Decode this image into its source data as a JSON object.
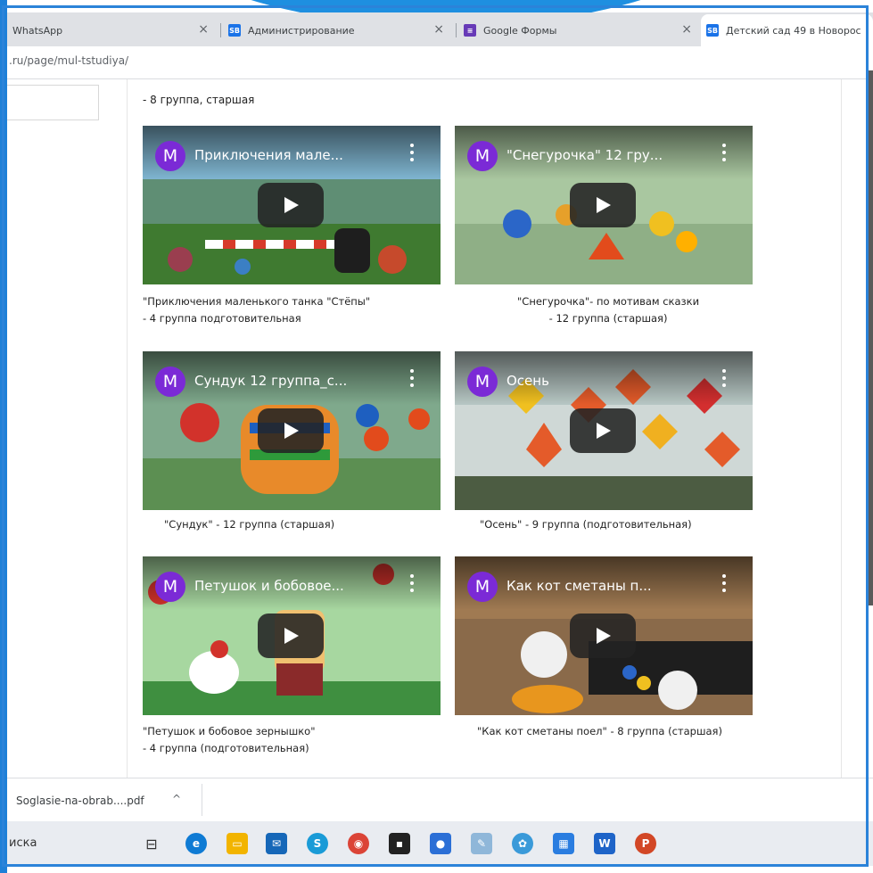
{
  "tabs": [
    {
      "title": "WhatsApp"
    },
    {
      "title": "Администрирование",
      "icon": "sites-icon"
    },
    {
      "title": "Google Формы",
      "icon": "forms-icon"
    },
    {
      "title": "Детский сад 49 в Новорос",
      "icon": "sites-icon"
    }
  ],
  "address": {
    "url": ".ru/page/mul-tstudiya/"
  },
  "top_label": "- 8 группа, старшая",
  "videos": [
    {
      "title": "Приключения мале...",
      "avatar": "М",
      "caption_line1": "\"Приключения маленького танка \"Стёпы\"",
      "caption_line2": "- 4 группа подготовительная"
    },
    {
      "title": "\"Снегурочка\" 12 гру...",
      "avatar": "М",
      "caption_line1": "\"Снегурочка\"- по мотивам сказки",
      "caption_line2": "- 12 группа (старшая)"
    },
    {
      "title": "Сундук 12 группа_с...",
      "avatar": "М",
      "caption_line1": "\"Сундук\" - 12 группа (старшая)"
    },
    {
      "title": "Осень",
      "avatar": "М",
      "caption_line1": "\"Осень\" - 9 группа (подготовительная)"
    },
    {
      "title": "Петушок и бобовое...",
      "avatar": "М",
      "caption_line1": "\"Петушок и бобовое зернышко\"",
      "caption_line2": "- 4 группа (подготовительная)"
    },
    {
      "title": "Как кот сметаны п...",
      "avatar": "М",
      "caption_line1": "\"Как кот сметаны поел\" - 8 группа (старшая)"
    }
  ],
  "download": {
    "filename": "Soglasie-na-obrab....pdf"
  },
  "taskbar": {
    "search_text": "иска"
  },
  "colors": {
    "avatar": "#7b2ad6",
    "frame": "#2b83d9"
  }
}
